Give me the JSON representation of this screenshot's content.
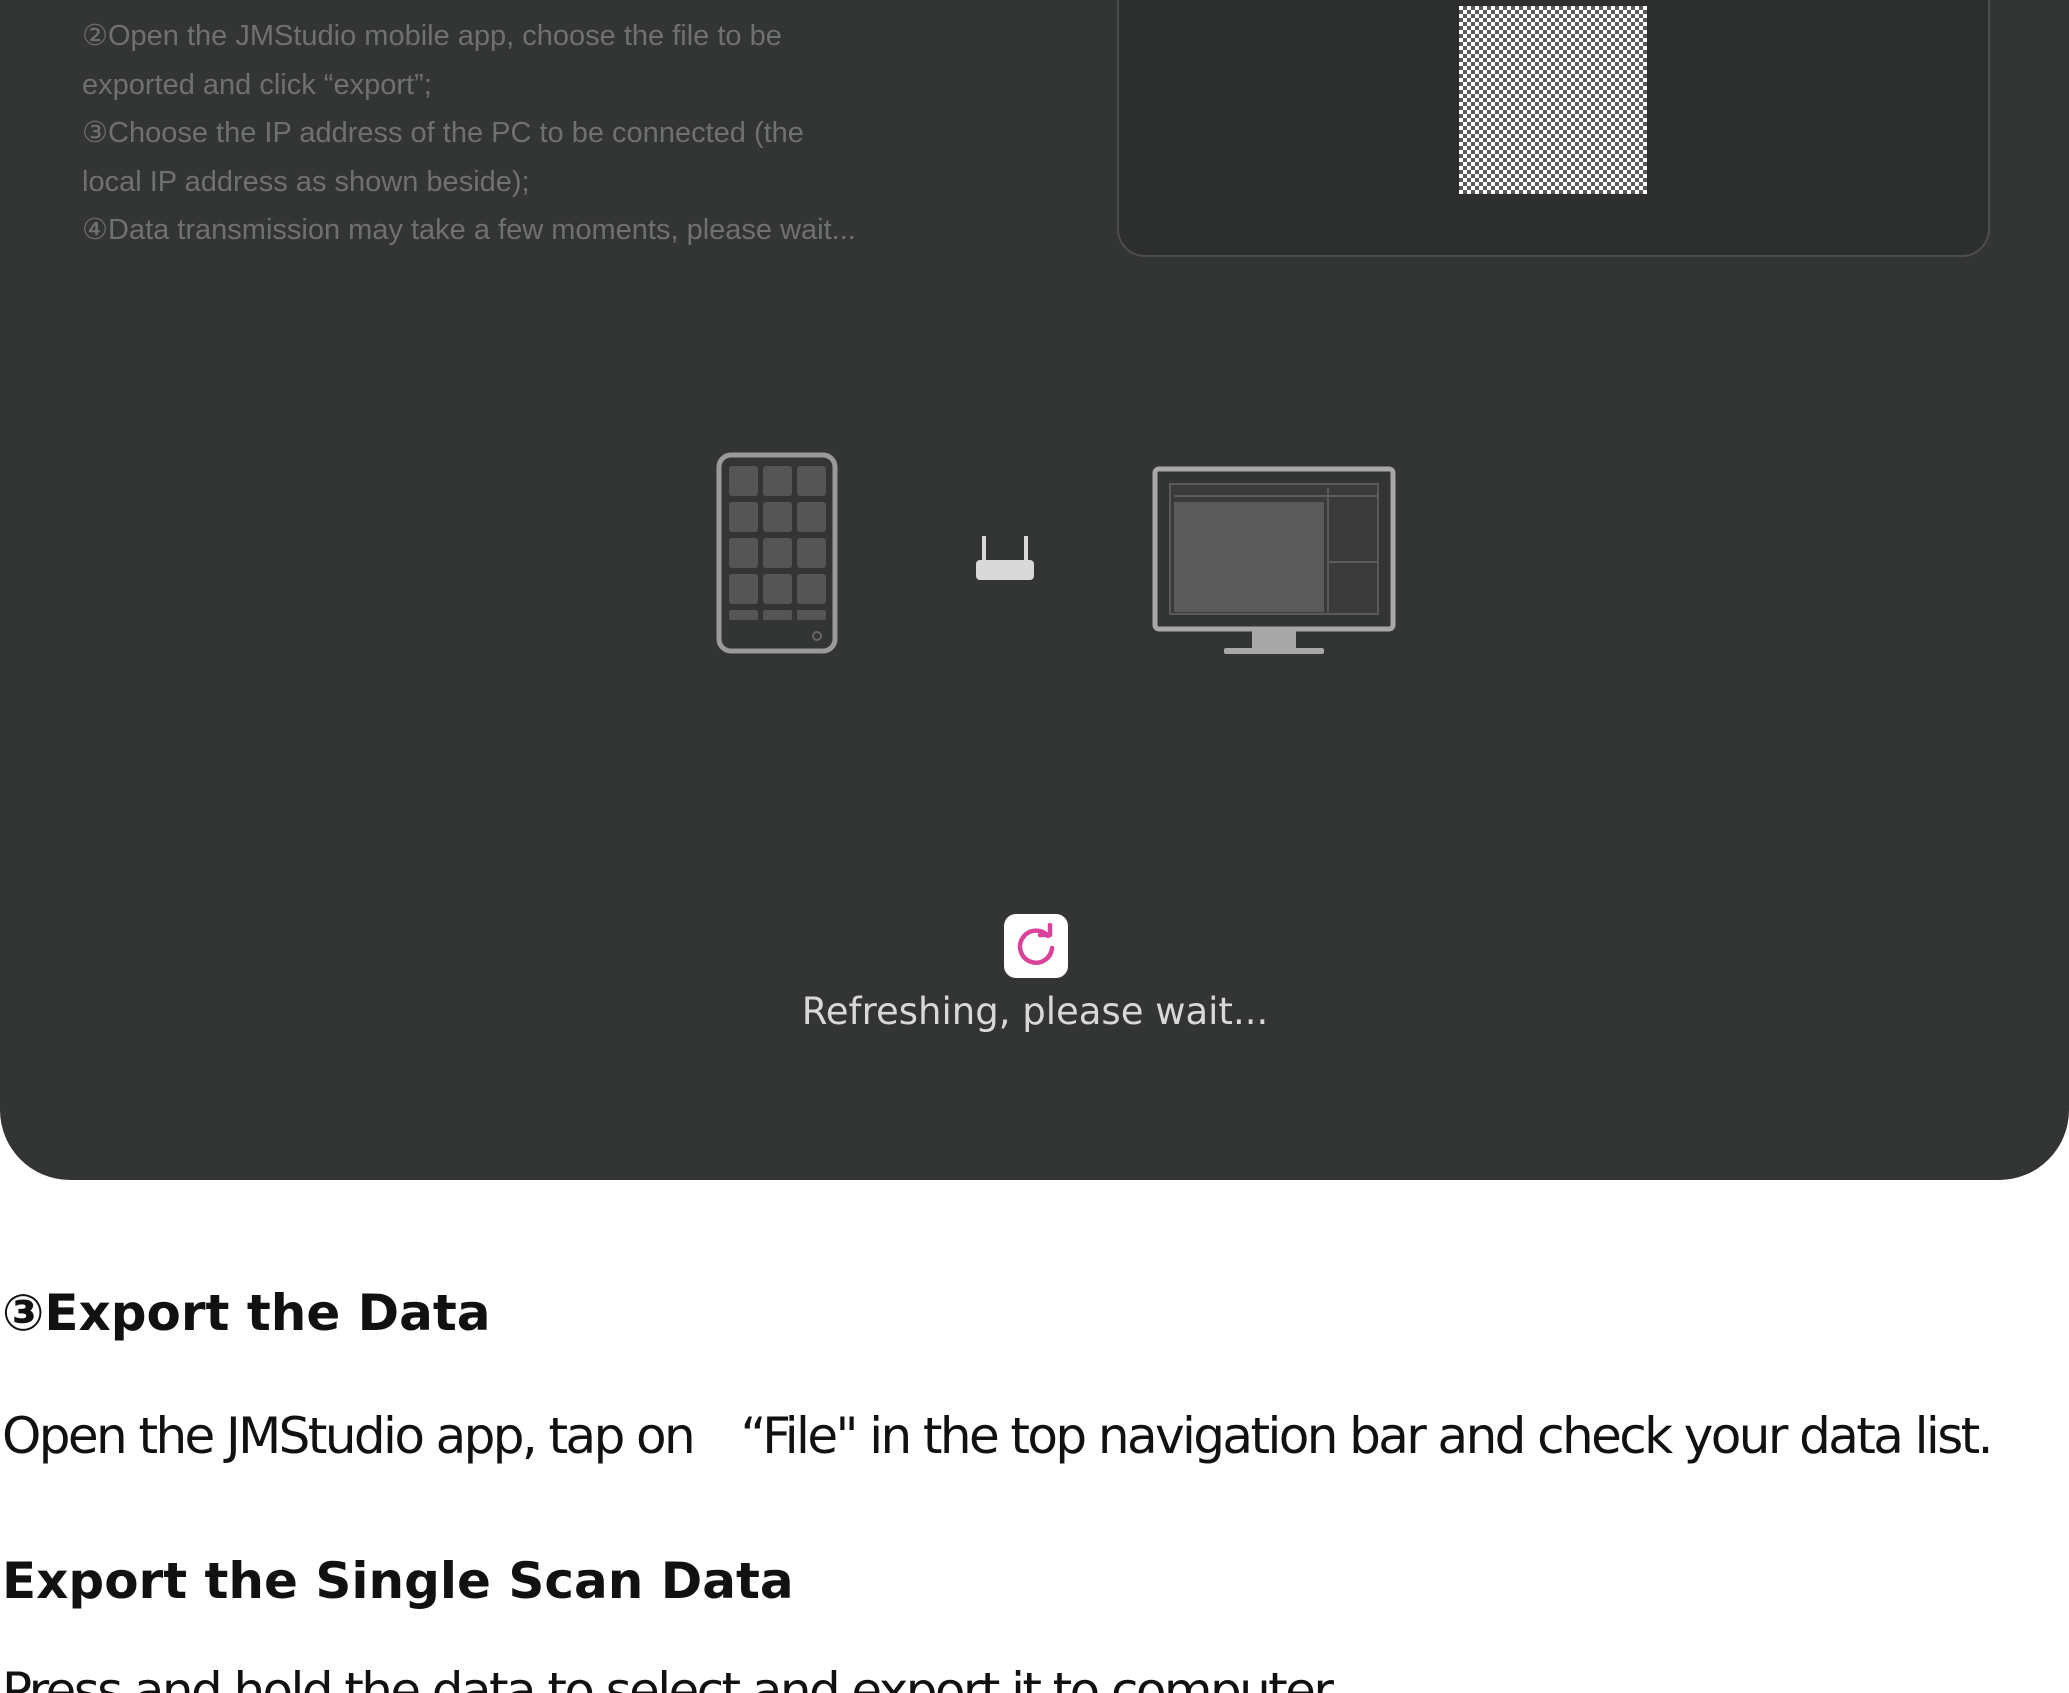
{
  "instructions": {
    "lines": [
      "②Open the JMStudio mobile app, choose the file to be",
      "exported and click “export”;",
      "③Choose the IP address of the PC to  be connected (the",
      "local IP address as shown beside);",
      "④Data transmission may take a few moments, please wait..."
    ]
  },
  "qr": {
    "icon": "qr-code-icon"
  },
  "illustration": {
    "phone_icon": "phone-icon",
    "router_icon": "router-icon",
    "monitor_icon": "monitor-icon"
  },
  "status": {
    "refresh_icon": "refresh-icon",
    "refresh_icon_color": "#d9449a",
    "text": "Refreshing, please wait..."
  },
  "document": {
    "export_heading": "③Export the Data",
    "export_paragraph": "Open the JMStudio app, tap on　“File\" in the top navigation bar and check your data list.",
    "single_heading": "Export the Single Scan Data",
    "single_paragraph": "Press and hold the data to select and export it to computer."
  },
  "colors": {
    "panel_background": "#333434",
    "accent": "#d9449a"
  }
}
